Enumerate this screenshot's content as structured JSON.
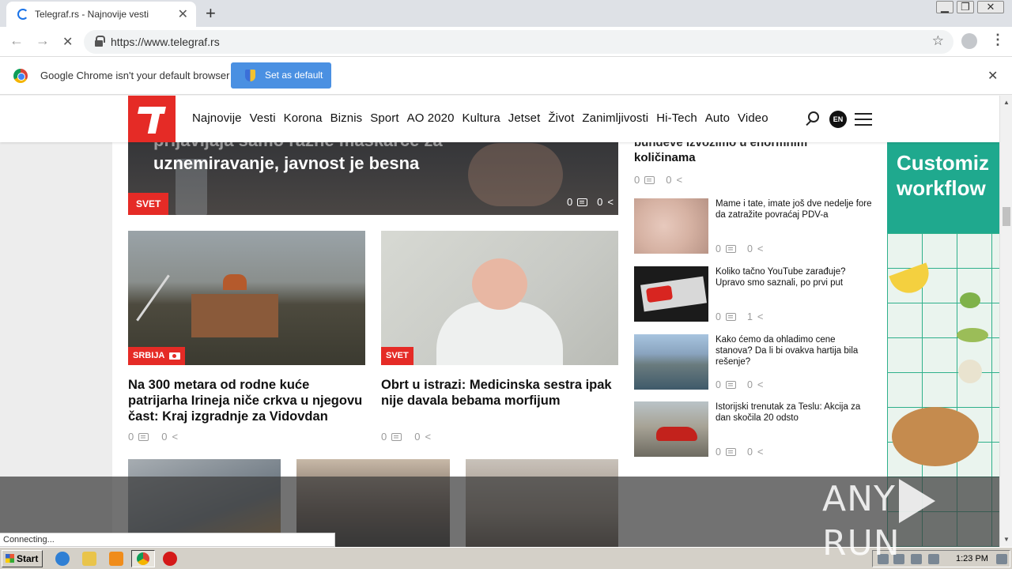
{
  "browser": {
    "tab_title": "Telegraf.rs - Najnovije vesti",
    "tab_close": "✕",
    "new_tab": "+",
    "url": "https://www.telegraf.rs",
    "back": "←",
    "forward": "→",
    "reload": "✕",
    "bookmark_star": "☆",
    "menu": "⋮",
    "window_controls": [
      "▁",
      "❐",
      "✕"
    ]
  },
  "infobar": {
    "message": "Google Chrome isn't your default browser",
    "button_label": "Set as default",
    "close": "✕"
  },
  "site": {
    "nav": [
      "Najnovije",
      "Vesti",
      "Korona",
      "Biznis",
      "Sport",
      "AO 2020",
      "Kultura",
      "Jetset",
      "Život",
      "Zanimljivosti",
      "Hi-Tech",
      "Auto",
      "Video"
    ],
    "lang": "EN"
  },
  "hero": {
    "title_cut": "prijavljaja samo razne maskarce za",
    "title": "uznemiravanje, javnost je besna",
    "category": "SVET",
    "comments": "0",
    "shares": "0"
  },
  "cards": [
    {
      "category": "SRBIJA",
      "title": "Na 300 metara od rodne kuće patrijarha Irineja niče crkva u njegovu čast: Kraj izgradnje za Vidovdan",
      "comments": "0",
      "shares": "0"
    },
    {
      "category": "SVET",
      "title": "Obrt u istrazi: Medicinska sestra ipak nije davala bebama morfijum",
      "comments": "0",
      "shares": "0"
    }
  ],
  "sidebar": {
    "top_title_cut": "bundeve izvozimo u enormnim",
    "top_title": "količinama",
    "top_comments": "0",
    "top_shares": "0",
    "items": [
      {
        "title": "Mame i tate, imate još dve nedelje fore da zatražite povraćaj PDV-a",
        "comments": "0",
        "shares": "0"
      },
      {
        "title": "Koliko tačno YouTube zarađuje? Upravo smo saznali, po prvi put",
        "comments": "0",
        "shares": "1"
      },
      {
        "title": "Kako ćemo da ohladimo cene stanova? Da li bi ovakva hartija bila rešenje?",
        "comments": "0",
        "shares": "0"
      },
      {
        "title": "Istorijski trenutak za Teslu: Akcija za dan skočila 20 odsto",
        "comments": "0",
        "shares": "0"
      }
    ]
  },
  "ad": {
    "headline_line1": "Customiz",
    "headline_line2": "workflow"
  },
  "status": {
    "text": "Connecting..."
  },
  "watermark": {
    "left": "ANY",
    "right": "RUN"
  },
  "taskbar": {
    "start_label": "Start",
    "clock": "1:23 PM"
  },
  "colors": {
    "brand_red": "#e52b26",
    "chrome_blue_button": "#4a90e2",
    "ad_green": "#1fa98e"
  }
}
